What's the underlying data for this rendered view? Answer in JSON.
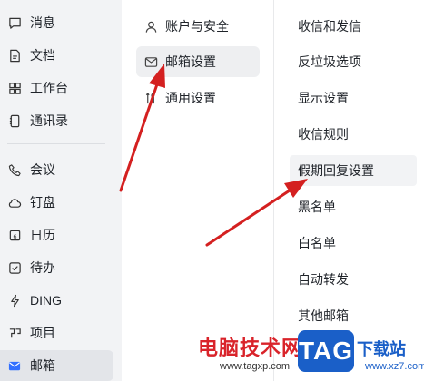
{
  "sidebar": {
    "items": [
      {
        "label": "消息",
        "icon": "chat-bubble-icon"
      },
      {
        "label": "文档",
        "icon": "document-icon"
      },
      {
        "label": "工作台",
        "icon": "grid-icon"
      },
      {
        "label": "通讯录",
        "icon": "contacts-icon"
      },
      {
        "label": "会议",
        "icon": "phone-icon"
      },
      {
        "label": "钉盘",
        "icon": "cloud-icon"
      },
      {
        "label": "日历",
        "icon": "calendar-icon"
      },
      {
        "label": "待办",
        "icon": "checkbox-icon"
      },
      {
        "label": "DING",
        "icon": "lightning-icon"
      },
      {
        "label": "项目",
        "icon": "project-icon"
      },
      {
        "label": "邮箱",
        "icon": "mail-icon",
        "active": true
      }
    ]
  },
  "settings_menu": {
    "items": [
      {
        "label": "账户与安全",
        "icon": "user-icon"
      },
      {
        "label": "邮箱设置",
        "icon": "mail-settings-icon",
        "active": true
      },
      {
        "label": "通用设置",
        "icon": "tools-icon"
      }
    ]
  },
  "mail_settings": {
    "items": [
      {
        "label": "收信和发信"
      },
      {
        "label": "反垃圾选项"
      },
      {
        "label": "显示设置"
      },
      {
        "label": "收信规则"
      },
      {
        "label": "假期回复设置",
        "active": true
      },
      {
        "label": "黑名单"
      },
      {
        "label": "白名单"
      },
      {
        "label": "自动转发"
      },
      {
        "label": "其他邮箱"
      }
    ]
  },
  "watermark": {
    "site_name": "电脑技术网",
    "site_url": "www.tagxp.com",
    "logo_text": "TAG",
    "logo_suffix": "下载站",
    "logo_url": "www.xz7.com"
  },
  "colors": {
    "accent": "#3370ff",
    "arrow": "#d42020",
    "sidebar_bg": "#f2f3f5",
    "watermark_red": "#d9232a",
    "watermark_blue": "#1a5fc8"
  }
}
